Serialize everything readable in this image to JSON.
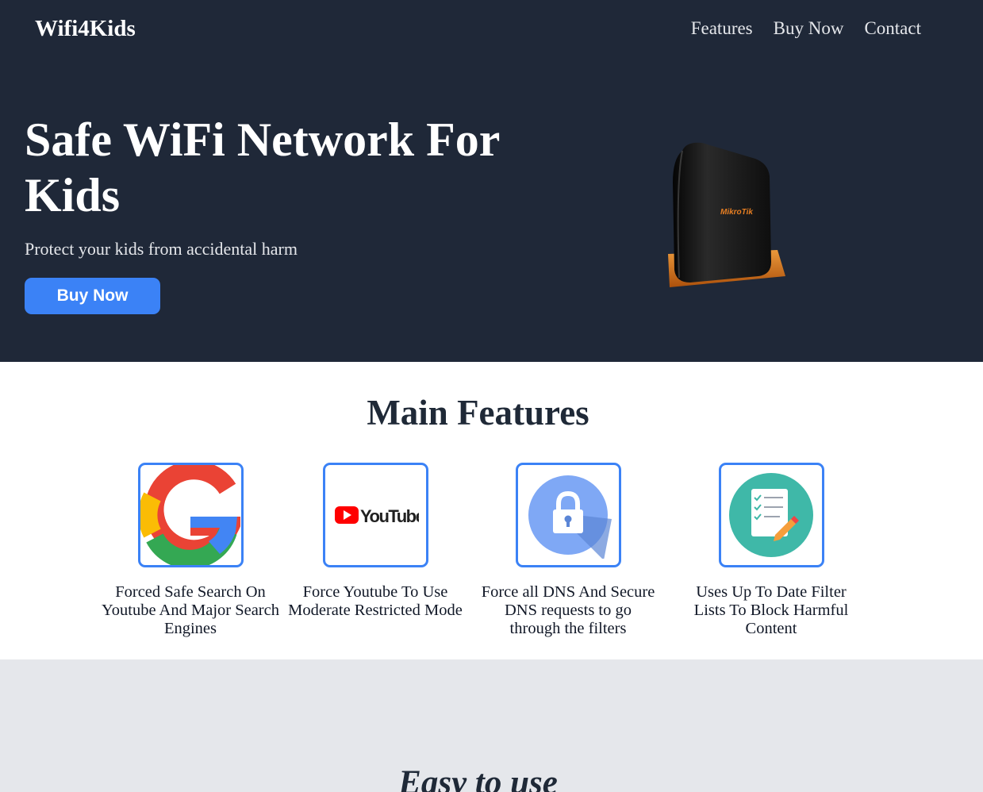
{
  "header": {
    "brand": "Wifi4Kids",
    "nav": [
      "Features",
      "Buy Now",
      "Contact"
    ]
  },
  "hero": {
    "title": "Safe WiFi Network For Kids",
    "subtitle": "Protect your kids from accidental harm",
    "cta_label": "Buy Now",
    "router_logo_text": "MikroTik"
  },
  "features": {
    "title": "Main Features",
    "items": [
      {
        "icon": "google-icon",
        "text": "Forced Safe Search On Youtube And Major Search Engines"
      },
      {
        "icon": "youtube-icon",
        "text": "Force Youtube To Use Moderate Restricted Mode"
      },
      {
        "icon": "lock-icon",
        "text": "Force all DNS And Secure DNS requests to go through the filters"
      },
      {
        "icon": "checklist-icon",
        "text": "Uses Up To Date Filter Lists To Block Harmful Content"
      }
    ],
    "youtube_wordmark": "YouTube"
  },
  "next_section": {
    "title": "Easy to use"
  },
  "colors": {
    "hero_bg": "#1f2838",
    "accent": "#3b82f6",
    "features_bg": "#ffffff",
    "section_bg": "#e5e7eb"
  }
}
